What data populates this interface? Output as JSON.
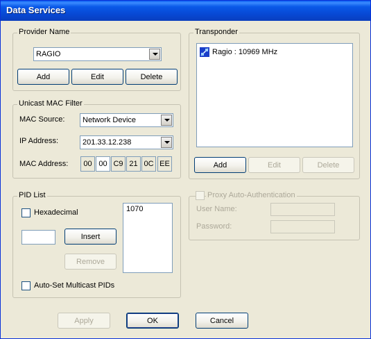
{
  "window": {
    "title": "Data Services"
  },
  "provider": {
    "group_label": "Provider Name",
    "selected": "RAGIO",
    "buttons": {
      "add": "Add",
      "edit": "Edit",
      "delete": "Delete"
    }
  },
  "transponder": {
    "group_label": "Transponder",
    "items": [
      {
        "label": "Ragio : 10969 MHz",
        "icon": "satellite-icon"
      }
    ],
    "buttons": {
      "add": "Add",
      "edit": "Edit",
      "delete": "Delete"
    }
  },
  "unicast": {
    "group_label": "Unicast MAC Filter",
    "mac_source_label": "MAC Source:",
    "mac_source_value": "Network Device",
    "ip_label": "IP Address:",
    "ip_value": "201.33.12.238",
    "mac_label": "MAC Address:",
    "mac_octets": [
      "00",
      "00",
      "C9",
      "21",
      "0C",
      "EE"
    ]
  },
  "pid": {
    "group_label": "PID List",
    "hexadecimal_label": "Hexadecimal",
    "input_value": "",
    "insert_label": "Insert",
    "remove_label": "Remove",
    "list_items": [
      "1070"
    ],
    "autoset_label": "Auto-Set Multicast PIDs"
  },
  "proxy": {
    "group_label": "Proxy Auto-Authentication",
    "username_label": "User Name:",
    "password_label": "Password:",
    "username_value": "",
    "password_value": ""
  },
  "footer": {
    "apply": "Apply",
    "ok": "OK",
    "cancel": "Cancel"
  }
}
